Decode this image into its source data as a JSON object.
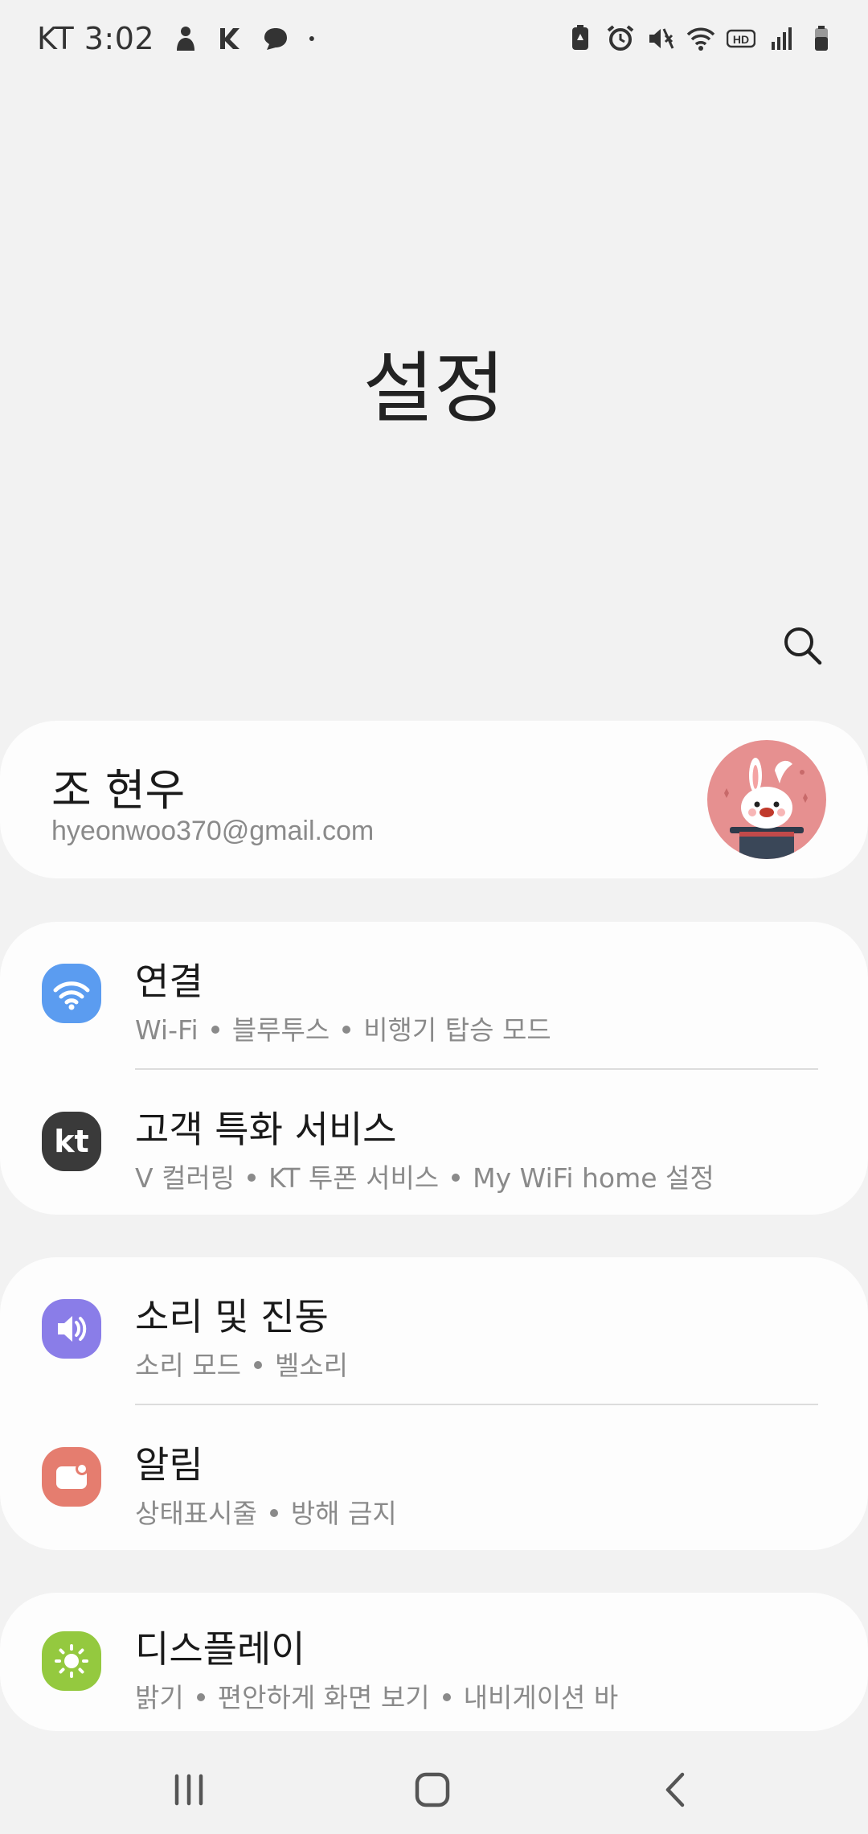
{
  "status_bar": {
    "carrier_time": "KT 3:02",
    "left_icons": [
      "person-icon",
      "kt-call-icon",
      "chat-bubble-icon",
      "notification-dot-icon"
    ],
    "right_icons": [
      "battery-saver-icon",
      "alarm-icon",
      "mute-icon",
      "wifi-icon",
      "hd-icon",
      "signal-icon",
      "battery-icon"
    ]
  },
  "header": {
    "title": "설정",
    "search_icon": "search-icon"
  },
  "profile": {
    "name": "조 현우",
    "email": "hyeonwoo370@gmail.com"
  },
  "groups": [
    {
      "items": [
        {
          "title": "연결",
          "subs": [
            "Wi-Fi",
            "블루투스",
            "비행기 탑승 모드"
          ],
          "icon": "wifi-icon",
          "color": "#5b9cf0"
        },
        {
          "title": "고객 특화 서비스",
          "subs": [
            "V 컬러링",
            "KT 투폰 서비스",
            "My WiFi home 설정"
          ],
          "icon": "kt-icon",
          "color": "#3a3a3a"
        }
      ]
    },
    {
      "items": [
        {
          "title": "소리 및 진동",
          "subs": [
            "소리 모드",
            "벨소리"
          ],
          "icon": "speaker-icon",
          "color": "#8a7de8"
        },
        {
          "title": "알림",
          "subs": [
            "상태표시줄",
            "방해 금지"
          ],
          "icon": "notification-icon",
          "color": "#e57d6f"
        }
      ]
    },
    {
      "items": [
        {
          "title": "디스플레이",
          "subs": [
            "밝기",
            "편안하게 화면 보기",
            "내비게이션 바"
          ],
          "icon": "brightness-icon",
          "color": "#94c93f"
        }
      ]
    }
  ],
  "navbar": {
    "recent_icon": "recent-apps-icon",
    "home_icon": "home-icon",
    "back_icon": "back-icon"
  }
}
